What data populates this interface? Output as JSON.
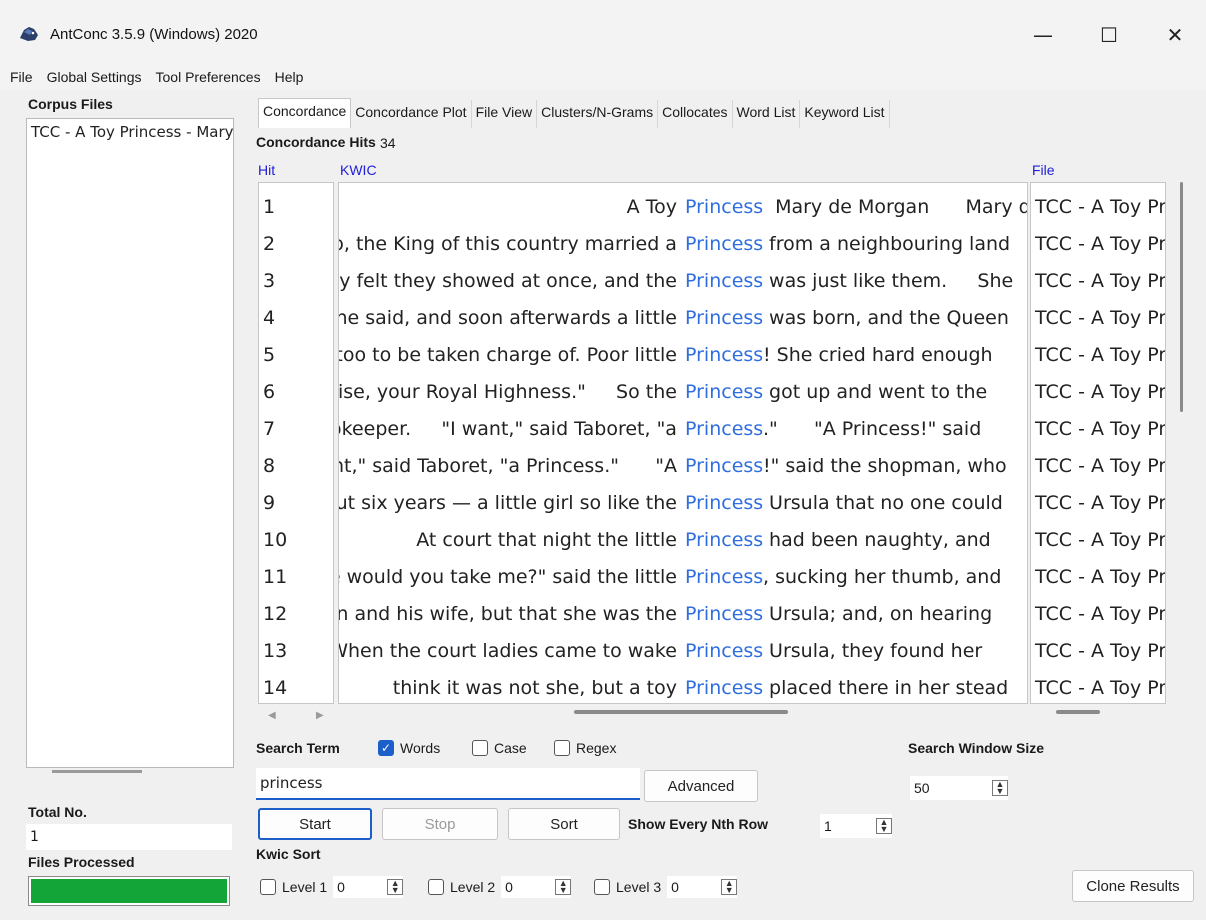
{
  "window": {
    "title": "AntConc 3.5.9 (Windows) 2020",
    "minimize_glyph": "—",
    "maximize_glyph": "☐",
    "close_glyph": "✕"
  },
  "menu": [
    "File",
    "Global Settings",
    "Tool Preferences",
    "Help"
  ],
  "left_panel": {
    "corpus_files_label": "Corpus Files",
    "corpus_files": [
      "TCC - A Toy Princess - Mary de Morgan.txt"
    ],
    "total_no_label": "Total No.",
    "total_no_value": "1",
    "files_processed_label": "Files Processed",
    "progress_fraction": 1.0,
    "progress_color": "#13a538"
  },
  "tabs": [
    "Concordance",
    "Concordance Plot",
    "File View",
    "Clusters/N-Grams",
    "Collocates",
    "Word List",
    "Keyword List"
  ],
  "active_tab": "Concordance",
  "results": {
    "hits_label": "Concordance Hits",
    "hits_count": "34",
    "col_hit": "Hit",
    "col_kwic": "KWIC",
    "col_file": "File",
    "node_color": "#2f6ee0",
    "rows": [
      {
        "hit": "1",
        "left": "A Toy ",
        "node": "Princess",
        "right": "  Mary de Morgan      Mary de",
        "file": "TCC - A Toy Princess"
      },
      {
        "hit": "2",
        "left": "More than a hundred years ago, the King of this country married a ",
        "node": "Princess",
        "right": " from a neighbouring land",
        "file": "TCC - A Toy Princess"
      },
      {
        "hit": "3",
        "left": "whatever they felt they showed at once, and the ",
        "node": "Princess",
        "right": " was just like them.     She",
        "file": "TCC - A Toy Princess"
      },
      {
        "hit": "4",
        "left": "\"Yes,\" she said, and soon afterwards a little ",
        "node": "Princess",
        "right": " was born, and the Queen",
        "file": "TCC - A Toy Princess"
      },
      {
        "hit": "5",
        "left": "she was too to be taken charge of. Poor little ",
        "node": "Princess",
        "right": "! She cried hard enough",
        "file": "TCC - A Toy Princess"
      },
      {
        "hit": "6",
        "left": "to rise, your Royal Highness.\"     So the ",
        "node": "Princess",
        "right": " got up and went to the",
        "file": "TCC - A Toy Princess"
      },
      {
        "hit": "7",
        "left": "the shopkeeper.     \"I want,\" said Taboret, \"a ",
        "node": "Princess",
        "right": ".\"      \"A Princess!\" said",
        "file": "TCC - A Toy Princess"
      },
      {
        "hit": "8",
        "left": "\"I want,\" said Taboret, \"a Princess.\"      \"A ",
        "node": "Princess",
        "right": "!\" said the shopman, who",
        "file": "TCC - A Toy Princess"
      },
      {
        "hit": "9",
        "left": "about six years — a little girl so like the ",
        "node": "Princess",
        "right": " Ursula that no one could",
        "file": "TCC - A Toy Princess"
      },
      {
        "hit": "10",
        "left": "     At court that night the little ",
        "node": "Princess",
        "right": " had been naughty, and",
        "file": "TCC - A Toy Princess"
      },
      {
        "hit": "11",
        "left": "\"Where would you take me?\" said the little ",
        "node": "Princess",
        "right": ", sucking her thumb, and",
        "file": "TCC - A Toy Princess"
      },
      {
        "hit": "12",
        "left": "the fisherman and his wife, but that she was the ",
        "node": "Princess",
        "right": " Ursula; and, on hearing",
        "file": "TCC - A Toy Princess"
      },
      {
        "hit": "13",
        "left": "When the court ladies came to wake ",
        "node": "Princess",
        "right": " Ursula, they found her",
        "file": "TCC - A Toy Princess"
      },
      {
        "hit": "14",
        "left": "think it was not she, but a toy ",
        "node": "Princess",
        "right": " placed there in her stead",
        "file": "TCC - A Toy Princess"
      }
    ]
  },
  "search": {
    "label": "Search Term",
    "words_label": "Words",
    "words_checked": true,
    "case_label": "Case",
    "case_checked": false,
    "regex_label": "Regex",
    "regex_checked": false,
    "term": "princess",
    "advanced_label": "Advanced",
    "start_label": "Start",
    "stop_label": "Stop",
    "sort_label": "Sort",
    "show_nth_label": "Show Every Nth Row",
    "nth_value": "1",
    "window_size_label": "Search Window Size",
    "window_size_value": "50"
  },
  "kwic_sort": {
    "label": "Kwic Sort",
    "levels": [
      {
        "label": "Level 1",
        "value": "0"
      },
      {
        "label": "Level 2",
        "value": "0"
      },
      {
        "label": "Level 3",
        "value": "0"
      }
    ],
    "clone_label": "Clone Results"
  }
}
